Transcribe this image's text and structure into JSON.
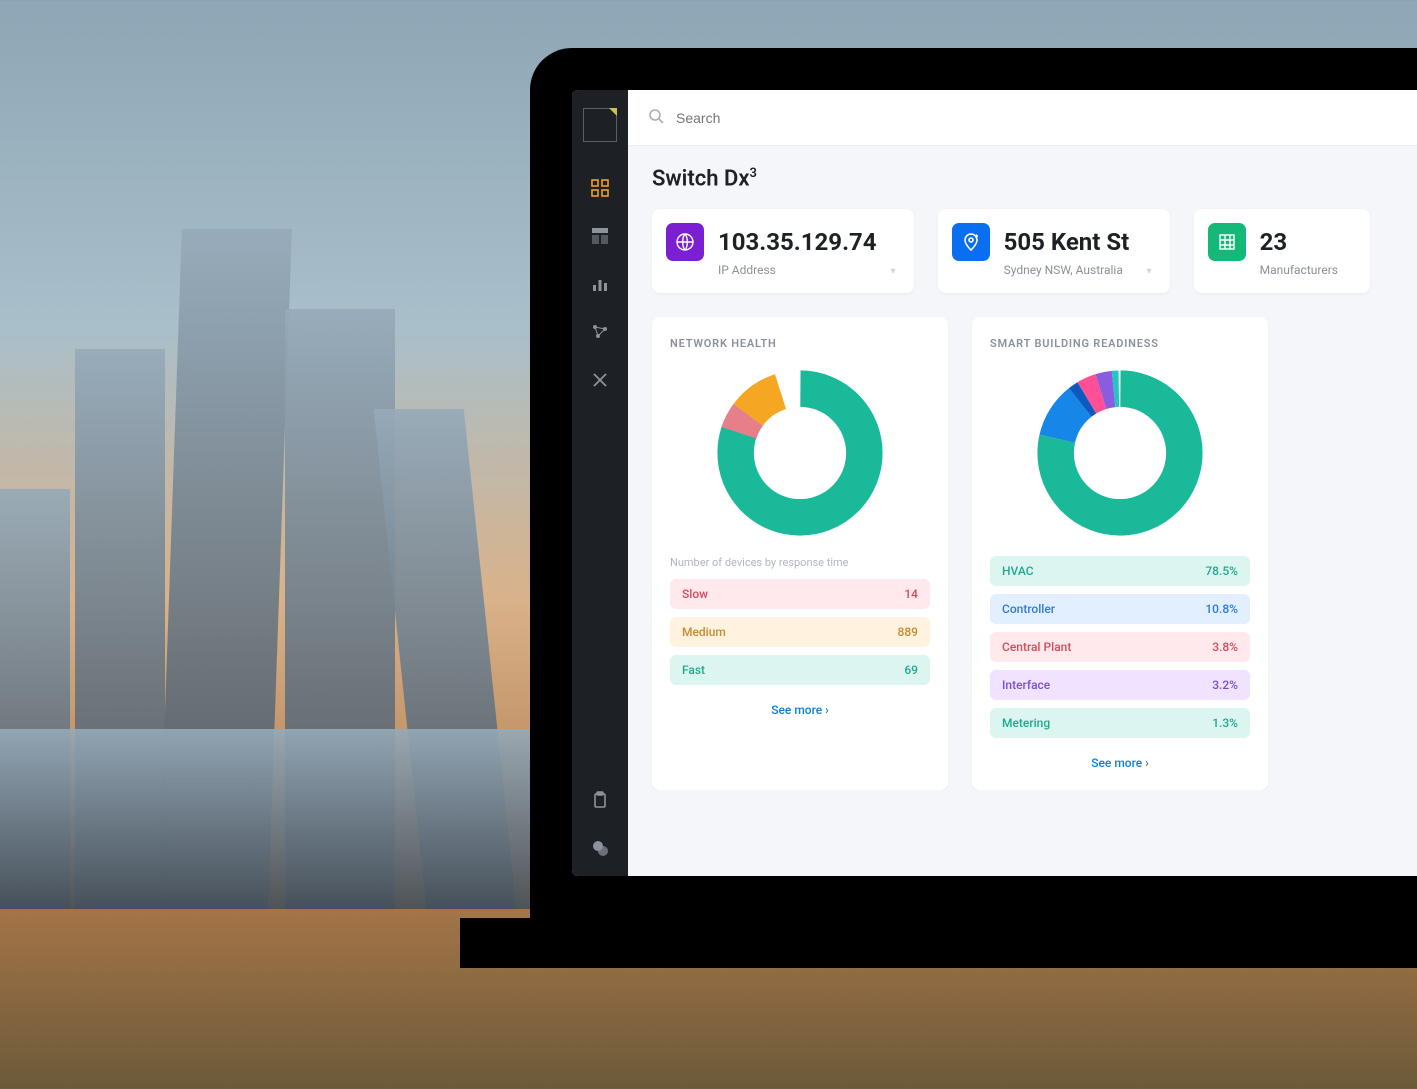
{
  "search": {
    "placeholder": "Search"
  },
  "page": {
    "title_main": "Switch Dx",
    "title_sup": "3"
  },
  "kpis": [
    {
      "value": "103.35.129.74",
      "label": "IP Address"
    },
    {
      "value": "505 Kent St",
      "label": "Sydney NSW, Australia"
    },
    {
      "value": "23",
      "label": "Manufacturers"
    }
  ],
  "network_card": {
    "title": "NETWORK HEALTH",
    "caption": "Number of devices by response time",
    "rows": [
      {
        "label": "Slow",
        "value": "14",
        "class": "pill-pink"
      },
      {
        "label": "Medium",
        "value": "889",
        "class": "pill-orange"
      },
      {
        "label": "Fast",
        "value": "69",
        "class": "pill-teal"
      }
    ],
    "see_more": "See more"
  },
  "readiness_card": {
    "title": "SMART BUILDING READINESS",
    "rows": [
      {
        "label": "HVAC",
        "value": "78.5%",
        "class": "pill-teal"
      },
      {
        "label": "Controller",
        "value": "10.8%",
        "class": "pill-blue"
      },
      {
        "label": "Central Plant",
        "value": "3.8%",
        "class": "pill-pink"
      },
      {
        "label": "Interface",
        "value": "3.2%",
        "class": "pill-purple"
      },
      {
        "label": "Metering",
        "value": "1.3%",
        "class": "pill-teal"
      }
    ],
    "see_more": "See more"
  },
  "chart_data": [
    {
      "type": "pie",
      "title": "NETWORK HEALTH",
      "series": [
        {
          "name": "Fast",
          "value": 69,
          "color": "#19b99a"
        },
        {
          "name": "Medium",
          "value": 889,
          "color": "#19b99a"
        },
        {
          "name": "Slow",
          "value": 14,
          "color": "#e77f8a"
        }
      ],
      "note": "Donut visually shows a large teal segment with a small pink sliver and an orange wedge (~10%)."
    },
    {
      "type": "pie",
      "title": "SMART BUILDING READINESS",
      "series": [
        {
          "name": "HVAC",
          "value": 78.5,
          "color": "#19b99a"
        },
        {
          "name": "Controller",
          "value": 10.8,
          "color": "#1686e8"
        },
        {
          "name": "Central Plant",
          "value": 3.8,
          "color": "#ff4f95"
        },
        {
          "name": "Interface",
          "value": 3.2,
          "color": "#8a5ce0"
        },
        {
          "name": "Metering",
          "value": 1.3,
          "color": "#1fc7c0"
        }
      ]
    }
  ]
}
